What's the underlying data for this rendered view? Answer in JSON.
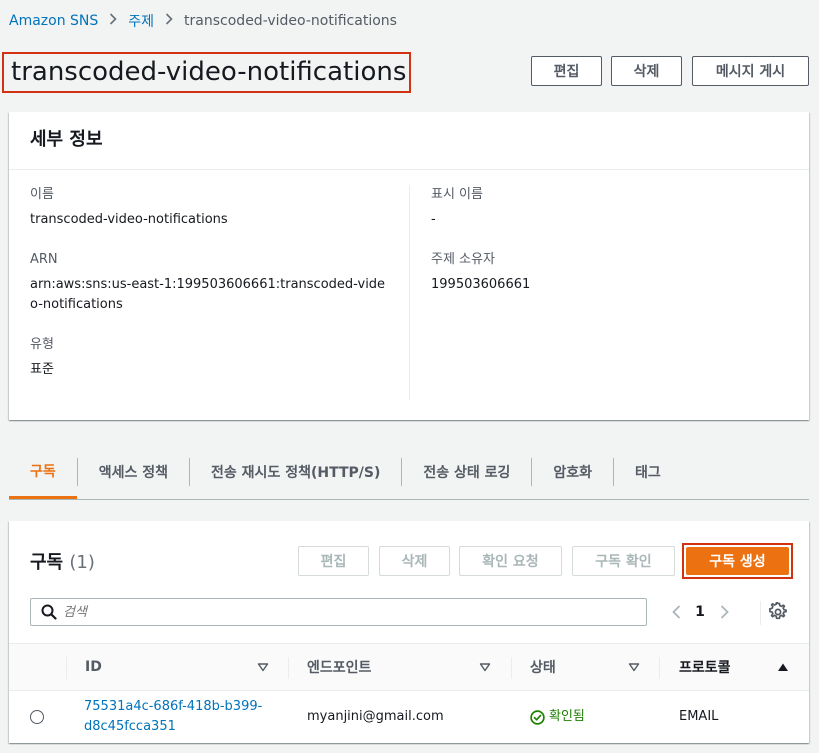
{
  "breadcrumb": {
    "root": "Amazon SNS",
    "section": "주제",
    "current": "transcoded-video-notifications"
  },
  "header": {
    "title": "transcoded-video-notifications",
    "edit_label": "편집",
    "delete_label": "삭제",
    "publish_label": "메시지 게시"
  },
  "details": {
    "heading": "세부 정보",
    "name_label": "이름",
    "name_value": "transcoded-video-notifications",
    "arn_label": "ARN",
    "arn_value": "arn:aws:sns:us-east-1:199503606661:transcoded-video-notifications",
    "type_label": "유형",
    "type_value": "표준",
    "display_name_label": "표시 이름",
    "display_name_value": "-",
    "owner_label": "주제 소유자",
    "owner_value": "199503606661"
  },
  "tabs": [
    {
      "label": "구독",
      "active": true
    },
    {
      "label": "액세스 정책",
      "active": false
    },
    {
      "label": "전송 재시도 정책(HTTP/S)",
      "active": false
    },
    {
      "label": "전송 상태 로깅",
      "active": false
    },
    {
      "label": "암호화",
      "active": false
    },
    {
      "label": "태그",
      "active": false
    }
  ],
  "subscriptions": {
    "title": "구독",
    "count": "(1)",
    "edit_label": "편집",
    "delete_label": "삭제",
    "request_confirm_label": "확인 요청",
    "confirm_label": "구독 확인",
    "create_label": "구독 생성",
    "search_placeholder": "검색",
    "page": "1",
    "columns": [
      "ID",
      "엔드포인트",
      "상태",
      "프로토콜"
    ],
    "rows": [
      {
        "id": "75531a4c-686f-418b-b399-d8c45fcca351",
        "endpoint": "myanjini@gmail.com",
        "status": "확인됨",
        "protocol": "EMAIL"
      }
    ]
  },
  "colors": {
    "accent": "#ec7211",
    "link": "#0073bb",
    "success": "#1d8102",
    "highlight_border": "#d13212"
  }
}
